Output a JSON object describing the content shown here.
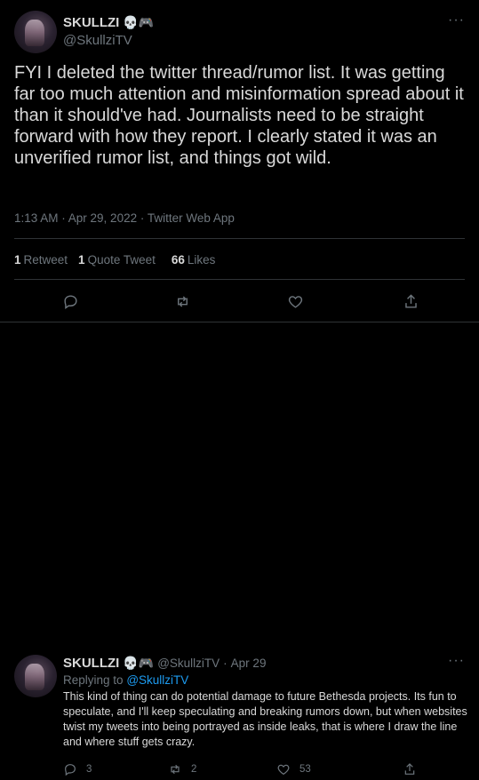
{
  "main_tweet": {
    "display_name": "SKULLZI",
    "name_emojis": "💀🎮",
    "handle": "@SkullziTV",
    "more": "···",
    "text": "FYI I deleted the twitter thread/rumor list.  It was getting far too much attention and misinformation spread about it than it should've had.  Journalists need to be straight forward with how they report.  I clearly stated it was an unverified rumor list, and things got wild.",
    "timestamp": "1:13 AM · Apr 29, 2022 · Twitter Web App",
    "stats": {
      "retweets_count": "1",
      "retweets_label": "Retweet",
      "quotes_count": "1",
      "quotes_label": "Quote Tweet",
      "likes_count": "66",
      "likes_label": "Likes"
    },
    "actions": [
      "reply-icon",
      "retweet-icon",
      "like-icon",
      "share-icon"
    ]
  },
  "reply_tweet": {
    "display_name": "SKULLZI",
    "name_emojis": "💀🎮",
    "handle": "@SkullziTV",
    "dot": "·",
    "date": "Apr 29",
    "more": "···",
    "replying_to_label": "Replying to",
    "replying_to_handle": "@SkullziTV",
    "text": "This kind of thing can do potential damage to future Bethesda projects.  Its fun to speculate, and I'll keep speculating and breaking rumors down, but when websites twist my tweets into being portrayed as inside leaks, that is where I draw the line and where stuff gets crazy.",
    "reply_count": "3",
    "retweet_count": "2",
    "like_count": "53"
  },
  "colors": {
    "background": "#000000",
    "text": "#d9d9d9",
    "muted": "#6e767d",
    "link": "#1d9bf0",
    "divider": "#2f3336"
  }
}
